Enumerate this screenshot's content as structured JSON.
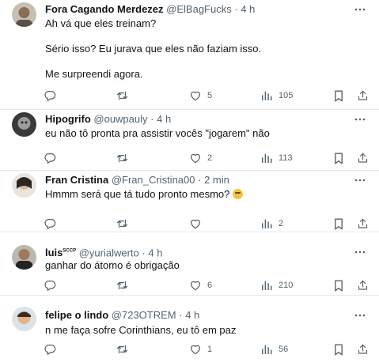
{
  "tweets": [
    {
      "name": "Fora Cagando Merdezez",
      "name_sup": "",
      "handle": "@ElBagFucks",
      "dot": "·",
      "time": "4 h",
      "text": "Ah vá que eles treinam?\n\nSério isso? Eu jurava que eles não faziam isso.\n\nMe surpreendi agora.",
      "emoji": "",
      "replies": "",
      "retweets": "",
      "likes": "5",
      "views": "105"
    },
    {
      "name": "Hipogrifo",
      "name_sup": "",
      "handle": "@ouwpauly",
      "dot": "·",
      "time": "4 h",
      "text": "eu não tô pronta pra assistir vocês \"jogarem\" não",
      "emoji": "",
      "replies": "",
      "retweets": "",
      "likes": "2",
      "views": "113"
    },
    {
      "name": "Fran Cristina",
      "name_sup": "",
      "handle": "@Fran_Cristina00",
      "dot": "·",
      "time": "2 min",
      "text": "Hmmm será que tá tudo pronto mesmo?",
      "emoji": "thinking-face",
      "replies": "",
      "retweets": "",
      "likes": "",
      "views": "2"
    },
    {
      "name": "luis",
      "name_sup": "SCCP",
      "handle": "@yurialwerto",
      "dot": "·",
      "time": "4 h",
      "text": "ganhar do átomo é obrigação",
      "emoji": "",
      "replies": "",
      "retweets": "",
      "likes": "6",
      "views": "210"
    },
    {
      "name": "felipe o lindo",
      "name_sup": "",
      "handle": "@723OTREM",
      "dot": "·",
      "time": "4 h",
      "text": "n me faça sofre Corinthians, eu tô em paz",
      "emoji": "",
      "replies": "",
      "retweets": "",
      "likes": "1",
      "views": "56"
    }
  ],
  "icons": {
    "reply": "reply-icon",
    "retweet": "retweet-icon",
    "like": "heart-icon",
    "views": "views-icon",
    "bookmark": "bookmark-icon",
    "share": "share-icon",
    "more": "more-options-icon"
  },
  "colors": {
    "text": "#0f1419",
    "secondary": "#536471",
    "divider": "#e4e8eb"
  }
}
